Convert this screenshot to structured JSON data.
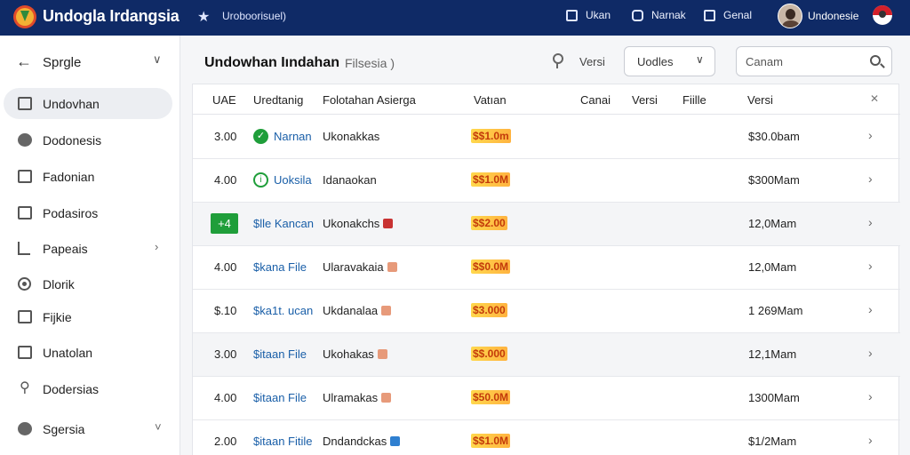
{
  "topbar": {
    "title": "Undogla Irdangsia",
    "subtitle": "Uroboorisuel)",
    "items": [
      {
        "icon": "calendar-icon",
        "label": "Ukan"
      },
      {
        "icon": "mail-icon",
        "label": "Narnak"
      },
      {
        "icon": "edit-icon",
        "label": "Genal"
      }
    ],
    "user": "Undonesie"
  },
  "sidebar": {
    "header": "Sprgle",
    "items": [
      {
        "label": "Undovhan",
        "icon": "calendar-icon",
        "active": true
      },
      {
        "label": "Dodonesis",
        "icon": "globe-icon"
      },
      {
        "label": "Fadonian",
        "icon": "window-icon"
      },
      {
        "label": "Podasiros",
        "icon": "briefcase-icon"
      },
      {
        "label": "Papeais",
        "icon": "chart-icon",
        "has_children": true
      },
      {
        "label": "Dlorik",
        "icon": "record-icon"
      },
      {
        "label": "Fijkie",
        "icon": "folder-icon"
      },
      {
        "label": "Unatolan",
        "icon": "document-icon"
      },
      {
        "label": "Dodersias",
        "icon": "flag-icon"
      },
      {
        "label": "Sgersia",
        "icon": "settings-icon",
        "has_children": true
      }
    ]
  },
  "main": {
    "title": "Undowhan Iındahan",
    "subtitle": "Filsesia )",
    "version_label": "Versi",
    "select_value": "Uodles",
    "search_placeholder": "Canam"
  },
  "table": {
    "columns": [
      "UAE",
      "Uredtanig",
      "Folotahan Asierga",
      "Vatıan",
      "Canai",
      "Versi",
      "Fiille",
      "Versi"
    ],
    "rows": [
      {
        "num": "3.00",
        "name": "Narnan",
        "desc": "Ukonakkas",
        "tag": "",
        "price": "$$1.0m",
        "size": "$30.0bam",
        "marker": "check"
      },
      {
        "num": "4.00",
        "name": "Uoksila",
        "desc": "Idanaokan",
        "tag": "",
        "price": "$$1.0M",
        "size": "$300Mam",
        "marker": "info"
      },
      {
        "num": "",
        "name": "$lle Kancan",
        "desc": "Ukonakchs",
        "tag": "red",
        "price": "$$2.00",
        "size": "12,0Mam",
        "marker": "badge"
      },
      {
        "num": "4.00",
        "name": "$kana File",
        "desc": "Ularavakaia",
        "tag": "peach",
        "price": "$$0.0M",
        "size": "12,0Mam",
        "marker": ""
      },
      {
        "num": "$.10",
        "name": "$ka1t. ucan",
        "desc": "Ukdanalaa",
        "tag": "peach",
        "price": "$3.000",
        "size": "1 269Mam",
        "marker": ""
      },
      {
        "num": "3.00",
        "name": "$itaan File",
        "desc": "Ukohakas",
        "tag": "peach",
        "price": "$$.000",
        "size": "12,1Mam",
        "marker": ""
      },
      {
        "num": "4.00",
        "name": "$itaan File",
        "desc": "Ulramakas",
        "tag": "peach",
        "price": "$50.0M",
        "size": "1300Mam",
        "marker": ""
      },
      {
        "num": "2.00",
        "name": "$itaan Fitile",
        "desc": "Dndandckas",
        "tag": "blue",
        "price": "$$1.0M",
        "size": "$1/2Mam",
        "marker": ""
      }
    ],
    "badge_glyph": "+4"
  },
  "colors": {
    "topbar": "#0f2a66",
    "accent_green": "#1f9e3a",
    "link_blue": "#1a5fa8",
    "price_red": "#c33a0a",
    "price_highlight": "#ffd84d"
  }
}
